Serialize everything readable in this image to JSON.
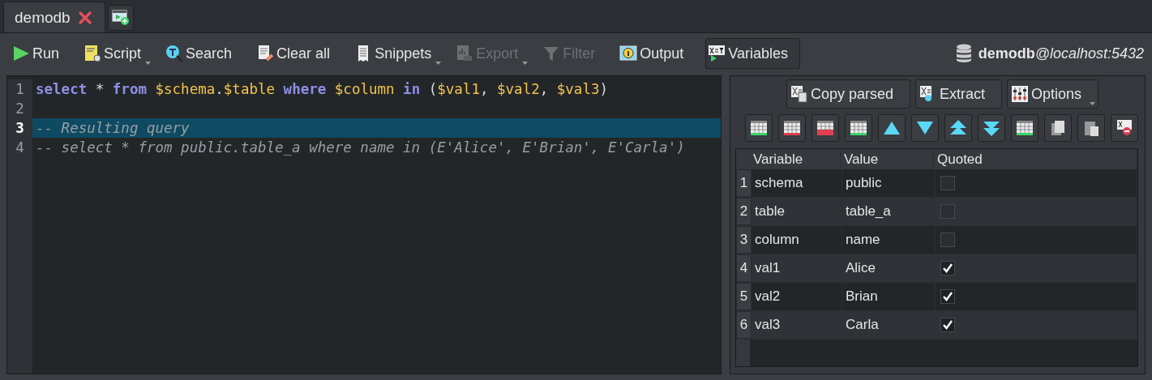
{
  "tabs": [
    {
      "label": "demodb",
      "selected": true
    }
  ],
  "toolbar": [
    {
      "label": "Run",
      "kind": "button",
      "disabled": false,
      "checked": false
    },
    {
      "label": "Script",
      "kind": "dropdown",
      "disabled": false,
      "checked": false
    },
    {
      "label": "Search",
      "kind": "button",
      "disabled": false,
      "checked": false
    },
    {
      "label": "Clear all",
      "kind": "button",
      "disabled": false,
      "checked": false
    },
    {
      "label": "Snippets",
      "kind": "dropdown",
      "disabled": false,
      "checked": false
    },
    {
      "label": "Export",
      "kind": "dropdown",
      "disabled": true,
      "checked": false
    },
    {
      "label": "Filter",
      "kind": "button",
      "disabled": true,
      "checked": false
    },
    {
      "label": "Output",
      "kind": "button",
      "disabled": false,
      "checked": false
    },
    {
      "label": "Variables",
      "kind": "button",
      "disabled": false,
      "checked": true
    }
  ],
  "connection": {
    "database": "demodb",
    "host": "@localhost:5432"
  },
  "editor": {
    "lines": [
      {
        "number": "1",
        "current": false,
        "tokens": [
          {
            "kind": "keyword",
            "text": "select"
          },
          {
            "kind": "plain",
            "text": " * "
          },
          {
            "kind": "keyword",
            "text": "from "
          },
          {
            "kind": "variable",
            "text": "$schema"
          },
          {
            "kind": "plain",
            "text": "."
          },
          {
            "kind": "variable",
            "text": "$table "
          },
          {
            "kind": "keyword",
            "text": "where "
          },
          {
            "kind": "variable",
            "text": "$column "
          },
          {
            "kind": "keyword",
            "text": "in "
          },
          {
            "kind": "plain",
            "text": "("
          },
          {
            "kind": "variable",
            "text": "$val1"
          },
          {
            "kind": "plain",
            "text": ", "
          },
          {
            "kind": "variable",
            "text": "$val2"
          },
          {
            "kind": "plain",
            "text": ", "
          },
          {
            "kind": "variable",
            "text": "$val3"
          },
          {
            "kind": "plain",
            "text": ")"
          }
        ]
      },
      {
        "number": "2",
        "current": false
      },
      {
        "number": "3",
        "current": true,
        "tokens": [
          {
            "kind": "comment",
            "text": "-- Resulting query"
          }
        ]
      },
      {
        "number": "4",
        "current": false,
        "tokens": [
          {
            "kind": "comment",
            "text": "-- select * from public.table_a where name in (E'Alice', E'Brian', E'Carla')"
          }
        ]
      }
    ]
  },
  "variables_panel": {
    "buttons": [
      {
        "label": "Copy parsed",
        "kind": "button"
      },
      {
        "label": "Extract",
        "kind": "button"
      },
      {
        "label": "Options",
        "kind": "dropdown"
      }
    ],
    "table": {
      "columns": [
        "Variable",
        "Value",
        "Quoted"
      ],
      "rows": [
        {
          "number": "1",
          "variable": "schema",
          "value": "public",
          "quoted": false
        },
        {
          "number": "2",
          "variable": "table",
          "value": "table_a",
          "quoted": false
        },
        {
          "number": "3",
          "variable": "column",
          "value": "name",
          "quoted": false
        },
        {
          "number": "4",
          "variable": "val1",
          "value": "Alice",
          "quoted": true
        },
        {
          "number": "5",
          "variable": "val2",
          "value": "Brian",
          "quoted": true
        },
        {
          "number": "6",
          "variable": "val3",
          "value": "Carla",
          "quoted": true
        }
      ]
    }
  }
}
